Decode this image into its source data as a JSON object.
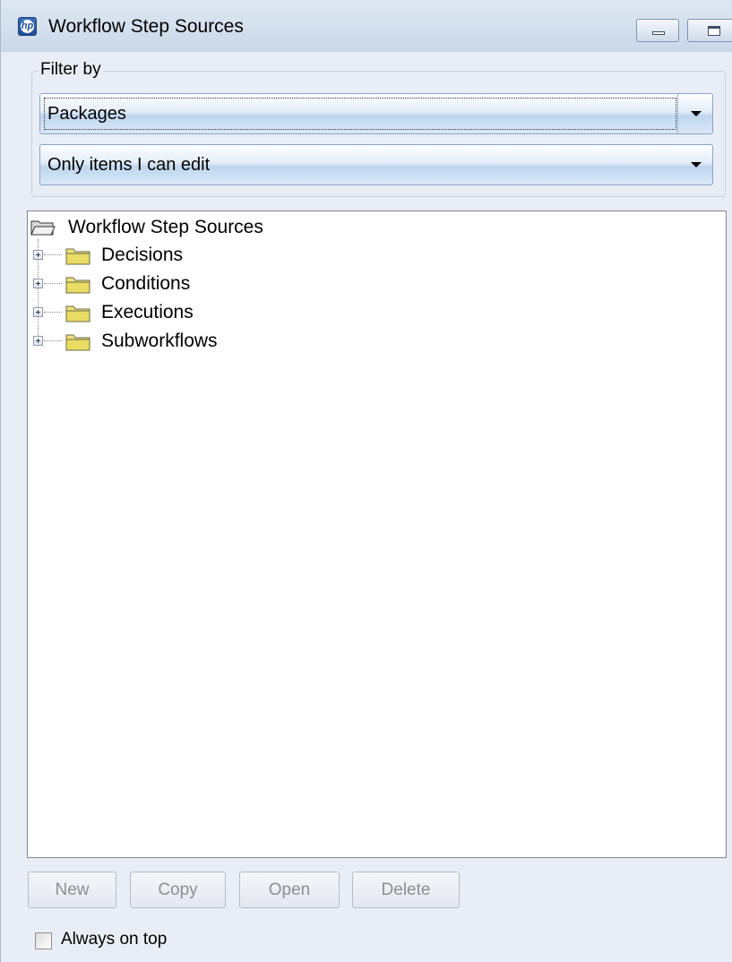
{
  "window": {
    "title": "Workflow Step Sources",
    "app_icon": "hp-logo-icon",
    "accent_color": "#1f4d95"
  },
  "filter": {
    "group_label": "Filter by",
    "type_select": {
      "selected": "Packages"
    },
    "scope_select": {
      "selected": "Only items I can edit"
    }
  },
  "tree": {
    "root": {
      "label": "Workflow Step Sources",
      "icon": "open-folder-icon"
    },
    "items": [
      {
        "label": "Decisions",
        "icon": "folder-icon"
      },
      {
        "label": "Conditions",
        "icon": "folder-icon"
      },
      {
        "label": "Executions",
        "icon": "folder-icon"
      },
      {
        "label": "Subworkflows",
        "icon": "folder-icon"
      }
    ]
  },
  "buttons": {
    "new": "New",
    "copy": "Copy",
    "open": "Open",
    "delete": "Delete"
  },
  "always_on_top": {
    "label": "Always on top",
    "checked": false
  }
}
